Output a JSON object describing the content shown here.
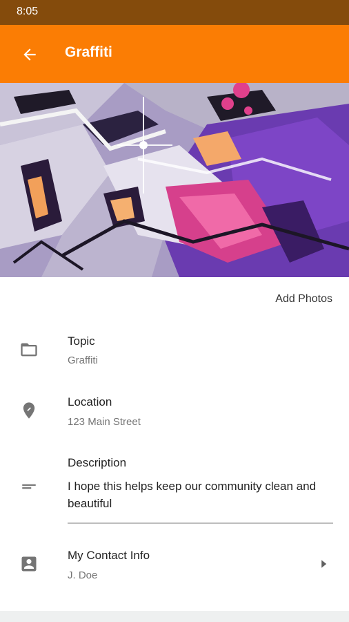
{
  "status_bar": {
    "time": "8:05"
  },
  "app_bar": {
    "title": "Graffiti",
    "back_icon": "arrow-back-icon"
  },
  "hero": {
    "image": "graffiti-photo"
  },
  "add_photos_label": "Add Photos",
  "fields": {
    "topic": {
      "label": "Topic",
      "value": "Graffiti",
      "icon": "folder-icon"
    },
    "location": {
      "label": "Location",
      "value": "123 Main Street",
      "icon": "location-pin-icon"
    },
    "description": {
      "label": "Description",
      "value": "I hope this helps keep our community clean and beautiful",
      "icon": "notes-icon"
    },
    "contact": {
      "label": "My Contact Info",
      "value": "J. Doe",
      "icon": "contact-card-icon",
      "chevron_icon": "chevron-right-icon"
    }
  },
  "colors": {
    "status_bar": "#844b0c",
    "app_bar": "#fb7d04",
    "icon_gray": "#757575"
  }
}
